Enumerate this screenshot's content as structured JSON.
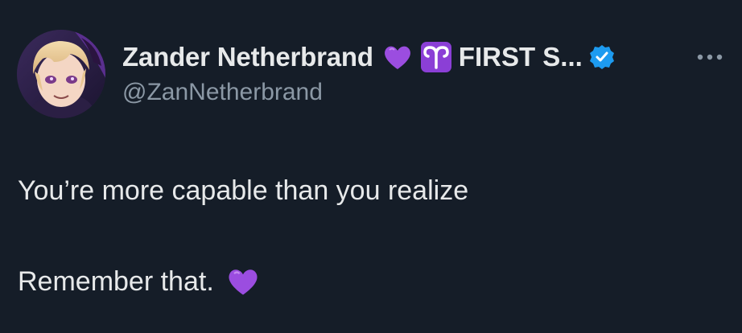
{
  "tweet": {
    "author": {
      "display_name": "Zander Netherbrand",
      "name_suffix": "FIRST S...",
      "handle": "@ZanNetherbrand",
      "name_emojis": [
        "purple-heart-icon",
        "aries-icon"
      ],
      "verified": true
    },
    "text_lines": [
      "You’re more capable than you realize",
      "Remember that."
    ],
    "trailing_emoji": "purple-heart-icon",
    "more_menu_icon": "more-options-icon"
  },
  "colors": {
    "background": "#151d28",
    "text_primary": "#e7e9ea",
    "text_secondary": "#8b98a5",
    "verified_blue": "#1d9bf0",
    "heart_purple": "#9b4de0",
    "aries_bg": "#8b3fd6"
  }
}
